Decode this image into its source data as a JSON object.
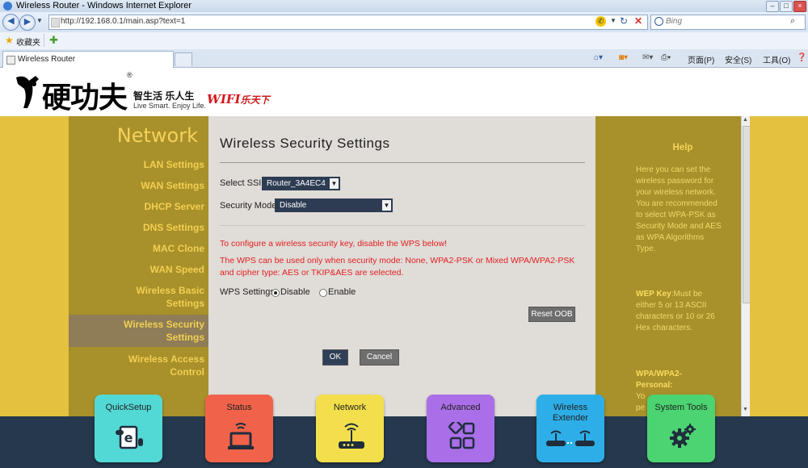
{
  "browser": {
    "window_title": "Wireless Router - Windows Internet Explorer",
    "address": "http://192.168.0.1/main.asp?text=1",
    "search_placeholder": "Bing",
    "favorites_label": "收藏夹",
    "tab_title": "Wireless Router",
    "commands": {
      "page": "页面(P)",
      "safety": "安全(S)",
      "tools": "工具(O)"
    }
  },
  "header": {
    "logo_text": "硬功夫",
    "slogan_cn": "智生活 乐人生",
    "slogan_en": "Live Smart. Enjoy Life.",
    "registered": "®",
    "wifi_text": "WIFI",
    "wifi_suffix": "乐天下"
  },
  "sidebar": {
    "title": "Network",
    "items": [
      {
        "label": "LAN Settings"
      },
      {
        "label": "WAN Settings"
      },
      {
        "label": "DHCP Server"
      },
      {
        "label": "DNS Settings"
      },
      {
        "label": "MAC Clone"
      },
      {
        "label": "WAN Speed"
      },
      {
        "label": "Wireless Basic",
        "label2": "Settings"
      },
      {
        "label": "Wireless Security",
        "label2": "Settings",
        "selected": true
      },
      {
        "label": "Wireless Access",
        "label2": "Control"
      }
    ]
  },
  "main": {
    "title": "Wireless Security Settings",
    "ssid_label": "Select SSID",
    "ssid_value": "Router_3A4EC4",
    "mode_label": "Security Mode",
    "mode_value": "Disable",
    "warning1": "To configure a wireless security key, disable the WPS below!",
    "warning2_line1": "The WPS can be used only when security mode: None, WPA2-PSK or Mixed WPA/WPA2-PSK",
    "warning2_line2": "and cipher type: AES or TKIP&AES are selected.",
    "wps_label": "WPS Settings",
    "wps_disable": "Disable",
    "wps_enable": "Enable",
    "wps_selected": "Disable",
    "reset_label": "Reset OOB",
    "ok_label": "OK",
    "cancel_label": "Cancel"
  },
  "help": {
    "title": "Help",
    "para1": [
      "Here you can set the",
      "wireless password for",
      "your wireless network.",
      "You are recommended",
      "to select WPA-PSK as",
      "Security Mode and AES",
      "as WPA Algorithms",
      "Type."
    ],
    "wep_key_label": "WEP Key",
    "wep_lines": [
      ":Must be",
      "either 5 or 13 ASCII",
      "characters or 10 or 26",
      "Hex characters."
    ],
    "wpa_label1": "WPA/WPA2-",
    "wpa_label2": "Personal:",
    "wpa_trail1": "Yo",
    "wpa_trail2": "pe"
  },
  "bottom_tiles": [
    {
      "label": "QuickSetup",
      "color": "#53d9d5",
      "icon": "quicksetup-icon"
    },
    {
      "label": "Status",
      "color": "#f0634a",
      "icon": "laptop-icon"
    },
    {
      "label": "Network",
      "color": "#f3df4b",
      "icon": "router-icon"
    },
    {
      "label": "Advanced",
      "color": "#a96ee8",
      "icon": "grid-icon"
    },
    {
      "label": "Wireless",
      "label2": "Extender",
      "color": "#2eaee8",
      "icon": "extender-icon"
    },
    {
      "label": "System Tools",
      "color": "#4bd471",
      "icon": "gear-icon"
    }
  ],
  "colors": {
    "stripe": "#e4c13f",
    "sidebar": "#a8902a",
    "content": "#e0dcd8",
    "bottom_bar": "#25384d",
    "warning": "#e02020"
  }
}
